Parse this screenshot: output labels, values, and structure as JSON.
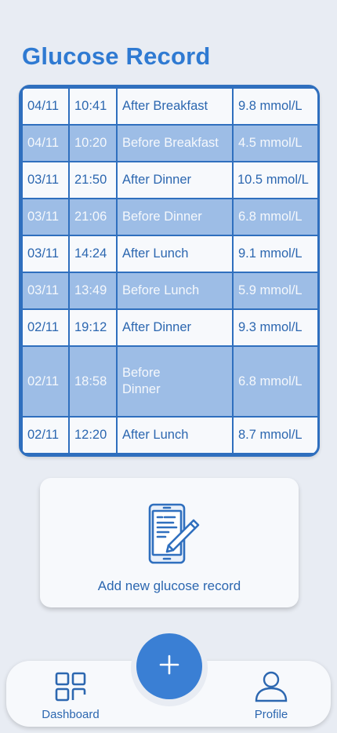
{
  "page": {
    "title": "Glucose Record"
  },
  "colors": {
    "accent": "#2f7ad2",
    "table_border": "#2f6fbe",
    "row_light": "#f7f9fc",
    "row_dark": "#9dbde6",
    "fab": "#3a7fd4"
  },
  "records": [
    {
      "date": "04/11",
      "time": "10:41",
      "meal": "After Breakfast",
      "value": "9.8 mmol/L"
    },
    {
      "date": "04/11",
      "time": "10:20",
      "meal": "Before Breakfast",
      "value": "4.5 mmol/L"
    },
    {
      "date": "03/11",
      "time": "21:50",
      "meal": "After Dinner",
      "value": "10.5 mmol/L"
    },
    {
      "date": "03/11",
      "time": "21:06",
      "meal": "Before Dinner",
      "value": "6.8 mmol/L"
    },
    {
      "date": "03/11",
      "time": "14:24",
      "meal": "After Lunch",
      "value": "9.1 mmol/L"
    },
    {
      "date": "03/11",
      "time": "13:49",
      "meal": "Before Lunch",
      "value": "5.9 mmol/L"
    },
    {
      "date": "02/11",
      "time": "19:12",
      "meal": "After Dinner",
      "value": "9.3 mmol/L"
    },
    {
      "date": "02/11",
      "time": "18:58",
      "meal": "Before Dinner",
      "value": "6.8 mmol/L"
    },
    {
      "date": "02/11",
      "time": "12:20",
      "meal": "After Lunch",
      "value": "8.7 mmol/L"
    }
  ],
  "add_card": {
    "label": "Add new glucose record",
    "icon": "phone-edit-icon"
  },
  "fab": {
    "symbol": "+",
    "icon": "plus-icon"
  },
  "nav": {
    "dashboard": {
      "label": "Dashboard",
      "icon": "grid-icon"
    },
    "profile": {
      "label": "Profile",
      "icon": "user-icon"
    }
  }
}
